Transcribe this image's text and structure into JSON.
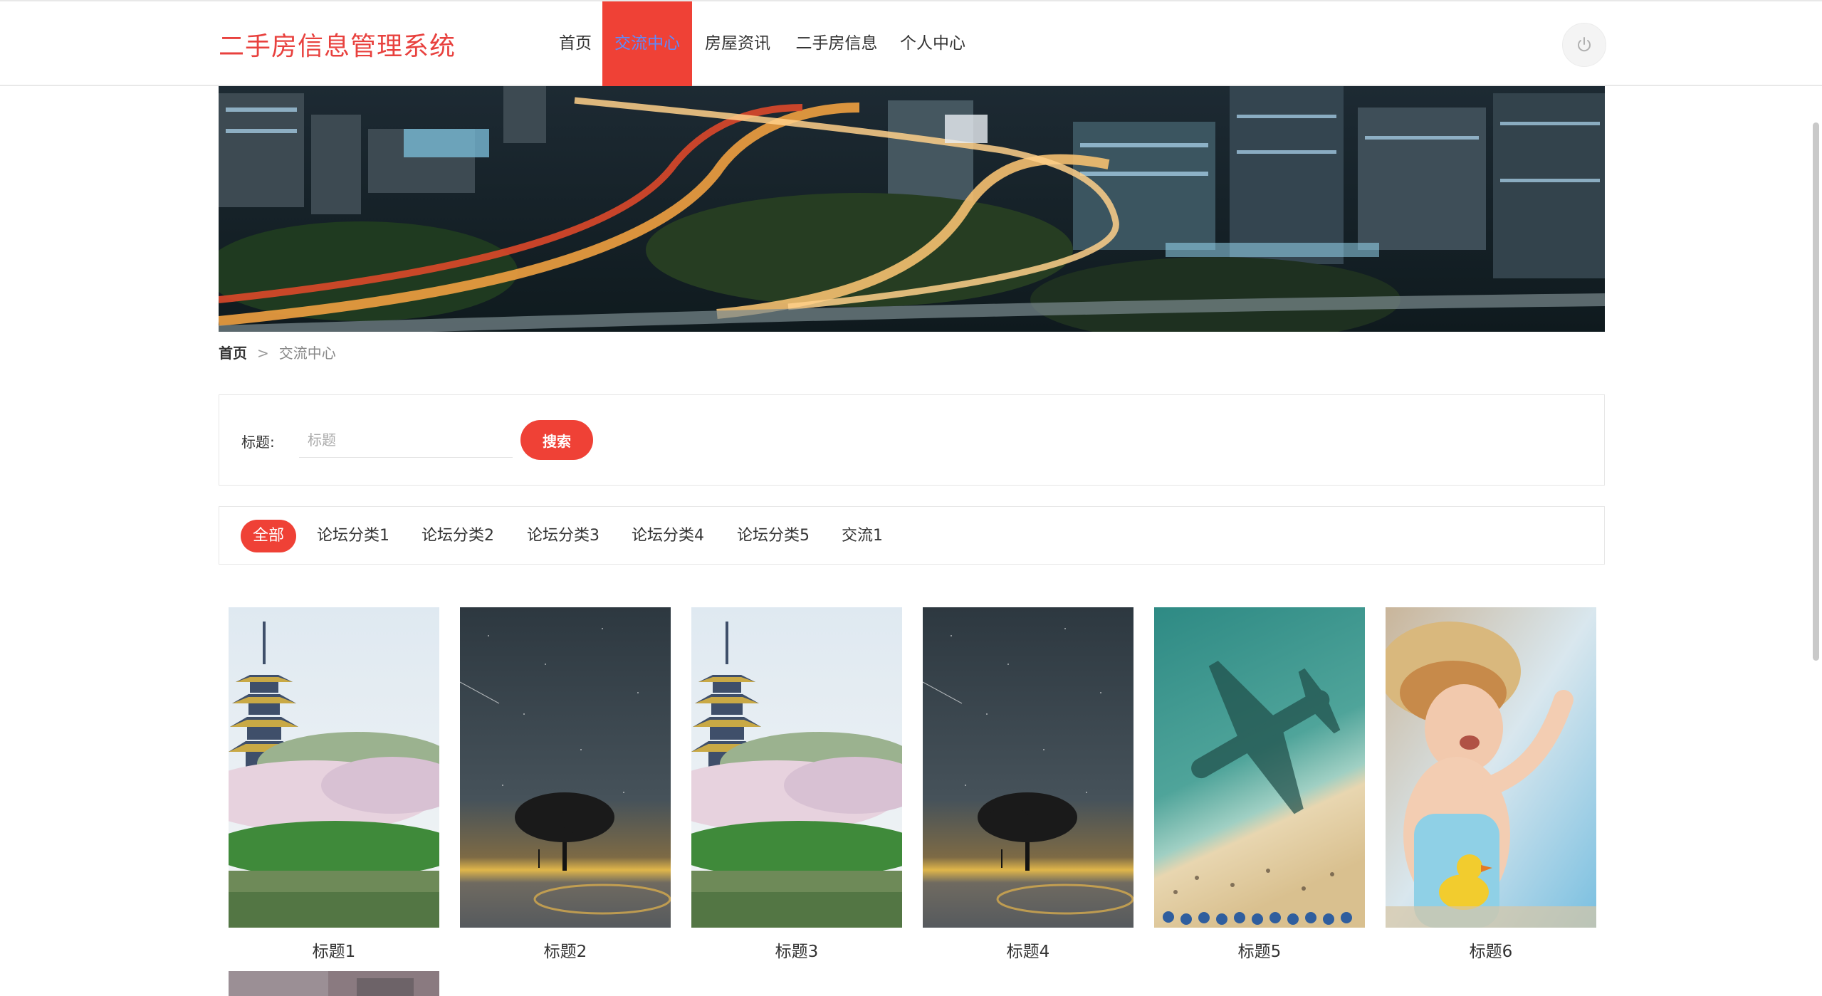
{
  "header": {
    "brand": "二手房信息管理系统",
    "nav": [
      {
        "label": "首页",
        "active": false
      },
      {
        "label": "交流中心",
        "active": true
      },
      {
        "label": "房屋资讯",
        "active": false
      },
      {
        "label": "二手房信息",
        "active": false
      },
      {
        "label": "个人中心",
        "active": false
      }
    ],
    "power_icon": "power-icon"
  },
  "breadcrumb": {
    "home": "首页",
    "separator": ">",
    "current": "交流中心"
  },
  "search": {
    "label": "标题:",
    "placeholder": "标题",
    "value": "",
    "button": "搜索"
  },
  "categories": [
    {
      "label": "全部",
      "active": true
    },
    {
      "label": "论坛分类1",
      "active": false
    },
    {
      "label": "论坛分类2",
      "active": false
    },
    {
      "label": "论坛分类3",
      "active": false
    },
    {
      "label": "论坛分类4",
      "active": false
    },
    {
      "label": "论坛分类5",
      "active": false
    },
    {
      "label": "交流1",
      "active": false
    }
  ],
  "posts": [
    {
      "title": "标题1",
      "image": "pagoda-cherry-blossom"
    },
    {
      "title": "标题2",
      "image": "tree-starry-night"
    },
    {
      "title": "标题3",
      "image": "pagoda-cherry-blossom"
    },
    {
      "title": "标题4",
      "image": "tree-starry-night"
    },
    {
      "title": "标题5",
      "image": "airplane-shadow-beach"
    },
    {
      "title": "标题6",
      "image": "child-in-pool"
    }
  ],
  "colors": {
    "accent": "#ef4136",
    "brand_text": "#e8413e",
    "active_nav_text": "#5c8bff"
  }
}
